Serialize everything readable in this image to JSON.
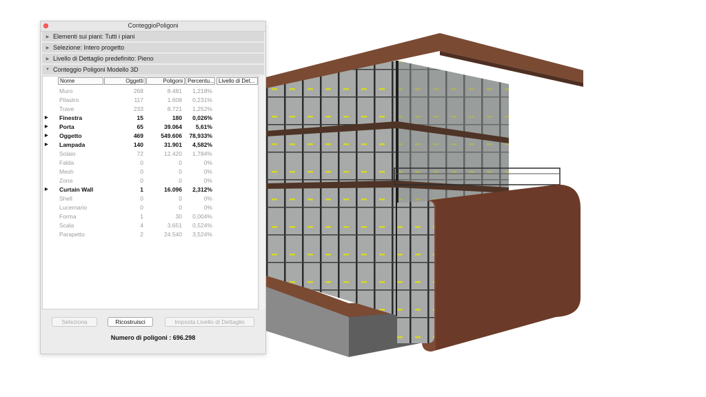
{
  "window": {
    "title": "ConteggioPoligoni"
  },
  "sections": [
    {
      "label": "Elementi sui piani: Tutti i piani",
      "expanded": false
    },
    {
      "label": "Selezione: Intero progetto",
      "expanded": false
    },
    {
      "label": "Livello di Dettaglio predefinito: Pieno",
      "expanded": false
    },
    {
      "label": "Conteggio Poligoni Modello 3D",
      "expanded": true
    }
  ],
  "table": {
    "headers": {
      "nome": "Nome",
      "oggetti": "Oggetti",
      "poligoni": "Poligoni",
      "percentuale": "Percentu...",
      "livello": "Livello di Det..."
    },
    "rows": [
      {
        "nome": "Muro",
        "oggetti": "268",
        "poligoni": "8.481",
        "perc": "1,218%",
        "bold": false,
        "expandable": false
      },
      {
        "nome": "Pilastro",
        "oggetti": "117",
        "poligoni": "1.608",
        "perc": "0,231%",
        "bold": false,
        "expandable": false
      },
      {
        "nome": "Trave",
        "oggetti": "233",
        "poligoni": "8.721",
        "perc": "1,252%",
        "bold": false,
        "expandable": false
      },
      {
        "nome": "Finestra",
        "oggetti": "15",
        "poligoni": "180",
        "perc": "0,026%",
        "bold": true,
        "expandable": true
      },
      {
        "nome": "Porta",
        "oggetti": "65",
        "poligoni": "39.064",
        "perc": "5,61%",
        "bold": true,
        "expandable": true
      },
      {
        "nome": "Oggetto",
        "oggetti": "469",
        "poligoni": "549.606",
        "perc": "78,933%",
        "bold": true,
        "expandable": true
      },
      {
        "nome": "Lampada",
        "oggetti": "140",
        "poligoni": "31.901",
        "perc": "4,582%",
        "bold": true,
        "expandable": true
      },
      {
        "nome": "Solaio",
        "oggetti": "72",
        "poligoni": "12.420",
        "perc": "1,784%",
        "bold": false,
        "expandable": false
      },
      {
        "nome": "Falda",
        "oggetti": "0",
        "poligoni": "0",
        "perc": "0%",
        "bold": false,
        "expandable": false
      },
      {
        "nome": "Mesh",
        "oggetti": "0",
        "poligoni": "0",
        "perc": "0%",
        "bold": false,
        "expandable": false
      },
      {
        "nome": "Zona",
        "oggetti": "0",
        "poligoni": "0",
        "perc": "0%",
        "bold": false,
        "expandable": false
      },
      {
        "nome": "Curtain Wall",
        "oggetti": "1",
        "poligoni": "16.096",
        "perc": "2,312%",
        "bold": true,
        "expandable": true
      },
      {
        "nome": "Shell",
        "oggetti": "0",
        "poligoni": "0",
        "perc": "0%",
        "bold": false,
        "expandable": false
      },
      {
        "nome": "Lucernario",
        "oggetti": "0",
        "poligoni": "0",
        "perc": "0%",
        "bold": false,
        "expandable": false
      },
      {
        "nome": "Forma",
        "oggetti": "1",
        "poligoni": "30",
        "perc": "0,004%",
        "bold": false,
        "expandable": false
      },
      {
        "nome": "Scala",
        "oggetti": "4",
        "poligoni": "3.651",
        "perc": "0,524%",
        "bold": false,
        "expandable": false
      },
      {
        "nome": "Parapetto",
        "oggetti": "2",
        "poligoni": "24.540",
        "perc": "3,524%",
        "bold": false,
        "expandable": false
      }
    ]
  },
  "buttons": {
    "seleziona": {
      "label": "Seleziona",
      "enabled": false
    },
    "ricostruisci": {
      "label": "Ricostruisci",
      "enabled": true
    },
    "imposta": {
      "label": "Imposta Livello di Dettaglio",
      "enabled": false
    }
  },
  "footer": {
    "count_label": "Numero di poligoni : 696.298"
  },
  "colors": {
    "close_button": "#ff5f57",
    "section_bg": "#d9d9d9",
    "dim_text": "#9b9b9b",
    "roof": "#7a4a33",
    "brick": "#6b3a28",
    "glass": "#a8acab",
    "mullion": "#2d2d2d",
    "lamp": "#d8d820"
  },
  "icons": {
    "close": "close-dot-icon",
    "section_collapsed": "disclosure-right-icon",
    "section_expanded": "disclosure-down-icon",
    "row_expand": "row-expand-triangle-icon"
  }
}
